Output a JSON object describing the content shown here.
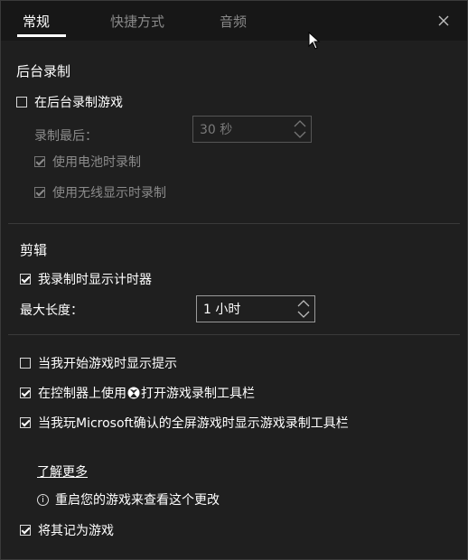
{
  "tabs": [
    {
      "label": "常规",
      "active": true
    },
    {
      "label": "快捷方式",
      "active": false
    },
    {
      "label": "音频",
      "active": false
    }
  ],
  "background_recording": {
    "title": "后台录制",
    "record_in_background_label": "在后台录制游戏",
    "record_in_background_checked": false,
    "record_last_label": "录制最后：",
    "record_last_value": "30 秒",
    "battery_label": "使用电池时录制",
    "battery_checked": true,
    "wireless_label": "使用无线显示时录制",
    "wireless_checked": true
  },
  "clips": {
    "title": "剪辑",
    "show_timer_label": "我录制时显示计时器",
    "show_timer_checked": true,
    "max_length_label": "最大长度：",
    "max_length_value": "1 小时"
  },
  "options": {
    "show_tips_label": "当我开始游戏时显示提示",
    "show_tips_checked": false,
    "controller_prefix": "在控制器上使用",
    "controller_suffix": "打开游戏录制工具栏",
    "controller_checked": true,
    "fullscreen_label": "当我玩Microsoft确认的全屏游戏时显示游戏录制工具栏",
    "fullscreen_checked": true
  },
  "learn_more": "了解更多",
  "restart_info": "重启您的游戏来查看这个更改",
  "remember_label": "将其记为游戏",
  "remember_checked": true,
  "icons": {
    "close": "close-icon",
    "cursor": "mouse-cursor-icon",
    "xbox": "xbox-logo-icon",
    "info": "info-icon"
  }
}
